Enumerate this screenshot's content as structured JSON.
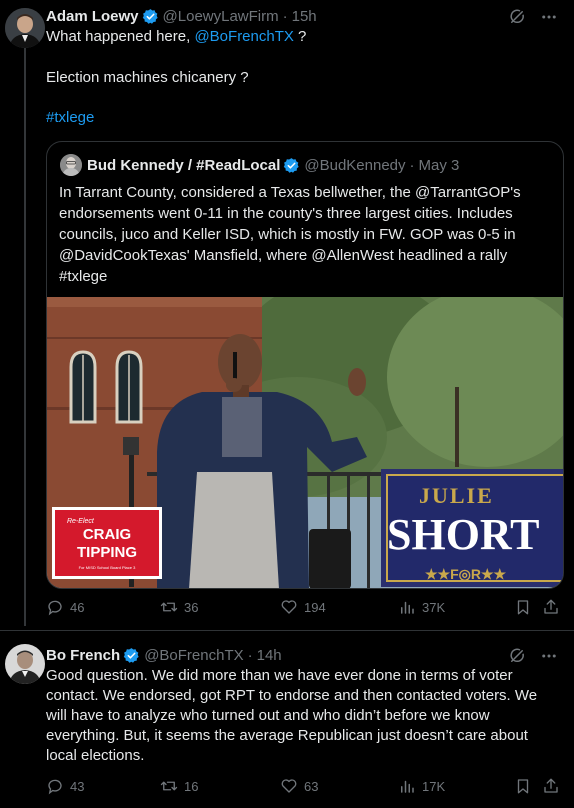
{
  "tweet1": {
    "author_name": "Adam Loewy",
    "handle": "@LoewyLawFirm",
    "separator": "·",
    "time": "15h",
    "text_prefix": "What happened here, ",
    "mention": "@BoFrenchTX",
    "text_suffix": " ?",
    "line2": "Election machines chicanery ?",
    "hashtag": "#txlege",
    "stats": {
      "replies": "46",
      "reposts": "36",
      "likes": "194",
      "views": "37K"
    }
  },
  "quote": {
    "author_name": "Bud Kennedy / #ReadLocal",
    "handle": "@BudKennedy",
    "separator": "·",
    "time": "May 3",
    "text": "In Tarrant County, considered a Texas bellwether, the @TarrantGOP's endorsements went 0-11 in the county's three largest cities. Includes councils, juco and Keller ISD, which is mostly in FW. GOP was 0-5 in @DavidCookTexas' Mansfield, where @AllenWest headlined a rally #txlege",
    "media": {
      "sign_left_small": "Re-Elect",
      "sign_left_line1": "CRAIG",
      "sign_left_line2": "TIPPING",
      "sign_left_footer": "For MISD School Board Place 3",
      "sign_right_line1": "JULIE",
      "sign_right_line2": "SHORT",
      "sign_right_line3": "★★F◎R★★"
    }
  },
  "tweet2": {
    "author_name": "Bo French",
    "handle": "@BoFrenchTX",
    "separator": "·",
    "time": "14h",
    "text": "Good question. We did more than we have ever done in terms of voter contact. We endorsed, got RPT to endorse and then contacted voters. We will have to analyze who turned out and who didn’t before we know everything. But, it seems the average Republican just doesn’t care about local elections.",
    "stats": {
      "replies": "43",
      "reposts": "16",
      "likes": "63",
      "views": "17K"
    }
  },
  "colors": {
    "link": "#1d9bf0",
    "verified": "#1d9bf0",
    "muted": "#71767b",
    "border": "#2f3336"
  }
}
